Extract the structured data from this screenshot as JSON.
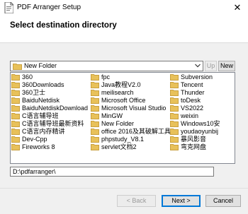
{
  "window": {
    "title": "PDF Arranger Setup",
    "close_glyph": "✕"
  },
  "header": {
    "title": "Select destination directory"
  },
  "directory_combo": {
    "value": "New Folder",
    "icon": "folder-icon"
  },
  "buttons": {
    "up": "Up",
    "new": "New",
    "back": "< Back",
    "next": "Next >",
    "cancel": "Cancel"
  },
  "folders": {
    "col1": [
      "360",
      "360Downloads",
      "360卫士",
      "BaiduNetdisk",
      "BaiduNetdiskDownload",
      "C语言辅导班",
      "C语言辅导班最新资料",
      "C语言内存精讲",
      "Dev-Cpp",
      "Fireworks 8"
    ],
    "col2": [
      "fpc",
      "Java教程V2.0",
      "meilisearch",
      "Microsoft Office",
      "Microsoft Visual Studio",
      "MinGW",
      "New Folder",
      "office 2016及其破解工具",
      "phpstudy_V8.1",
      "servlet文档2"
    ],
    "col3": [
      "Subversion",
      "Tencent",
      "Thunder",
      "toDesk",
      "VS2022",
      "weixin",
      "Windows10安",
      "youdaoyunbij",
      "暴风影音",
      "弯克网盘"
    ]
  },
  "selected_folder": "New Folder",
  "path_input": {
    "value": "D:\\pdfarranger\\"
  },
  "colors": {
    "folder": "#e8c15a",
    "folder_dark": "#c9a03e",
    "accent": "#0078d7",
    "disabled_text": "#9a9a9a"
  }
}
